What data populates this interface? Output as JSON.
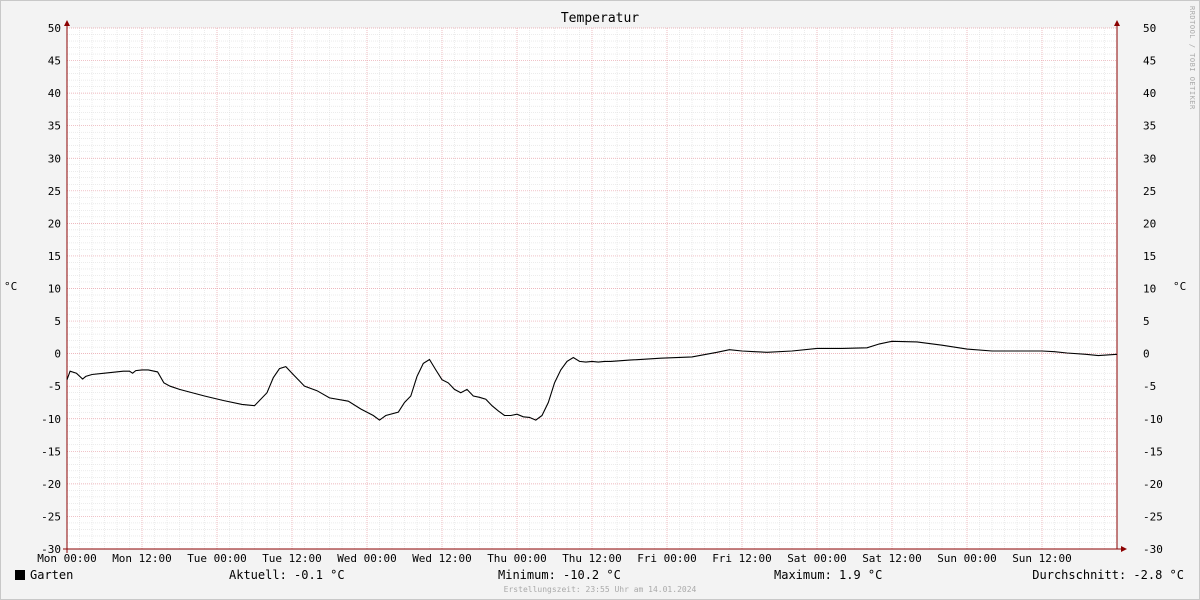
{
  "chart_data": {
    "type": "line",
    "title": "Temperatur",
    "ylabel": "°C",
    "ylim": [
      -30,
      50
    ],
    "yticks": [
      -30,
      -25,
      -20,
      -15,
      -10,
      -5,
      0,
      5,
      10,
      15,
      20,
      25,
      30,
      35,
      40,
      45,
      50
    ],
    "xlim_hours": [
      0,
      168
    ],
    "xticks": [
      "Mon 00:00",
      "Mon 12:00",
      "Tue 00:00",
      "Tue 12:00",
      "Wed 00:00",
      "Wed 12:00",
      "Thu 00:00",
      "Thu 12:00",
      "Fri 00:00",
      "Fri 12:00",
      "Sat 00:00",
      "Sat 12:00",
      "Sun 00:00",
      "Sun 12:00"
    ],
    "grid": true,
    "series": [
      {
        "name": "Garten",
        "color": "#000000",
        "x": [
          0,
          0.5,
          1.5,
          2.5,
          3,
          4,
          6,
          9,
          10,
          10.5,
          11,
          12,
          13,
          14.5,
          15.5,
          16.5,
          18,
          22,
          25,
          28,
          30,
          32,
          33,
          34,
          35,
          36,
          37,
          38,
          40,
          42,
          45,
          47,
          49,
          50,
          51,
          53,
          54,
          55,
          56,
          57,
          58,
          59,
          60,
          61,
          62,
          63,
          64,
          65,
          66,
          67,
          68,
          69,
          70,
          71,
          72,
          73,
          74,
          75,
          76,
          77,
          78,
          79,
          80,
          81,
          82,
          83,
          84,
          85,
          86,
          87,
          90,
          95,
          100,
          104,
          106,
          108,
          110,
          112,
          116,
          120,
          124,
          128,
          130,
          132,
          136,
          140,
          144,
          148,
          152,
          156,
          158,
          160,
          163,
          165,
          168
        ],
        "values": [
          -4,
          -2.7,
          -3,
          -3.9,
          -3.5,
          -3.2,
          -3,
          -2.7,
          -2.7,
          -3,
          -2.6,
          -2.5,
          -2.5,
          -2.8,
          -4.5,
          -5,
          -5.5,
          -6.5,
          -7.2,
          -7.8,
          -8,
          -6,
          -3.7,
          -2.3,
          -2,
          -3,
          -4,
          -5,
          -5.7,
          -6.8,
          -7.3,
          -8.5,
          -9.5,
          -10.2,
          -9.5,
          -9,
          -7.5,
          -6.5,
          -3.5,
          -1.5,
          -0.9,
          -2.5,
          -4,
          -4.5,
          -5.5,
          -6,
          -5.5,
          -6.5,
          -6.7,
          -7,
          -8,
          -8.8,
          -9.5,
          -9.5,
          -9.3,
          -9.7,
          -9.8,
          -10.2,
          -9.5,
          -7.5,
          -4.5,
          -2.5,
          -1.2,
          -0.6,
          -1.2,
          -1.3,
          -1.2,
          -1.3,
          -1.2,
          -1.2,
          -1,
          -0.7,
          -0.5,
          0.2,
          0.6,
          0.4,
          0.3,
          0.2,
          0.4,
          0.8,
          0.8,
          0.9,
          1.5,
          1.9,
          1.8,
          1.3,
          0.7,
          0.4,
          0.4,
          0.4,
          0.3,
          0.1,
          -0.1,
          -0.3,
          -0.1
        ]
      }
    ]
  },
  "legend": {
    "series_name": "Garten",
    "current": "Aktuell: -0.1 °C",
    "minimum": "Minimum: -10.2 °C",
    "maximum": "Maximum: 1.9 °C",
    "average": "Durchschnitt: -2.8 °C"
  },
  "footer": "Erstellungszeit: 23:55 Uhr am 14.01.2024",
  "watermark": "RRDTOOL / TOBI OETIKER",
  "colors": {
    "line": "#000000",
    "major_grid": "#e8a0a8",
    "minor_grid": "#d8d8d8",
    "axis": "#8b0000"
  }
}
